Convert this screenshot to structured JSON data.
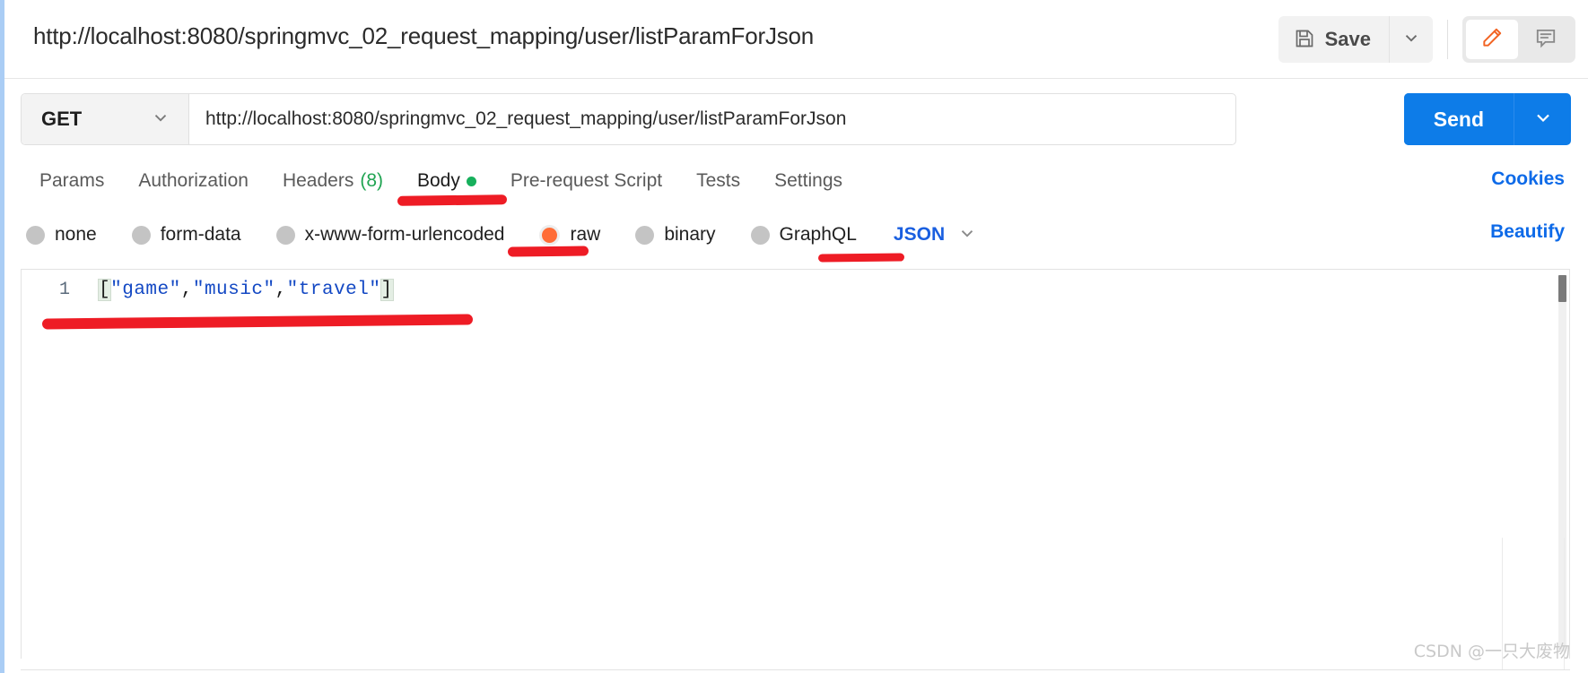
{
  "request": {
    "title": "http://localhost:8080/springmvc_02_request_mapping/user/listParamForJson",
    "method": "GET",
    "url": "http://localhost:8080/springmvc_02_request_mapping/user/listParamForJson"
  },
  "topbar": {
    "save_label": "Save",
    "save_icon": "floppy-disk-icon",
    "save_caret_icon": "chevron-down-icon",
    "edit_icon": "pencil-icon",
    "comment_icon": "comment-icon",
    "edit_icon_color": "#f26322"
  },
  "send": {
    "label": "Send",
    "caret_icon": "chevron-down-icon",
    "color": "#0d7ce8"
  },
  "tabs": [
    {
      "label": "Params",
      "active": false
    },
    {
      "label": "Authorization",
      "active": false
    },
    {
      "label": "Headers",
      "count": "(8)",
      "active": false
    },
    {
      "label": "Body",
      "active": true,
      "indicator": "green-dot"
    },
    {
      "label": "Pre-request Script",
      "active": false
    },
    {
      "label": "Tests",
      "active": false
    },
    {
      "label": "Settings",
      "active": false
    }
  ],
  "links": {
    "cookies": "Cookies",
    "beautify": "Beautify",
    "link_color": "#0d6ae8"
  },
  "body_modes": [
    {
      "label": "none",
      "selected": false
    },
    {
      "label": "form-data",
      "selected": false
    },
    {
      "label": "x-www-form-urlencoded",
      "selected": false
    },
    {
      "label": "raw",
      "selected": true
    },
    {
      "label": "binary",
      "selected": false
    },
    {
      "label": "GraphQL",
      "selected": false
    }
  ],
  "raw_format": {
    "value": "JSON",
    "caret_icon": "chevron-down-icon",
    "color": "#1a5fe0"
  },
  "selected_radio_color": "#ff6c37",
  "editor": {
    "line_number": "1",
    "tokens": [
      {
        "text": "[",
        "type": "bracket"
      },
      {
        "text": "\"game\"",
        "type": "string"
      },
      {
        "text": ",",
        "type": "punc"
      },
      {
        "text": "\"music\"",
        "type": "string"
      },
      {
        "text": ",",
        "type": "punc"
      },
      {
        "text": "\"travel\"",
        "type": "string"
      },
      {
        "text": "]",
        "type": "bracket"
      }
    ],
    "raw_content": "[\"game\",\"music\",\"travel\"]"
  },
  "annotations": {
    "color": "#ee1c25",
    "marks": [
      "body-tab-underline",
      "raw-radio-underline",
      "json-format-underline",
      "json-body-underline"
    ]
  },
  "watermark": "CSDN @一只大废物"
}
